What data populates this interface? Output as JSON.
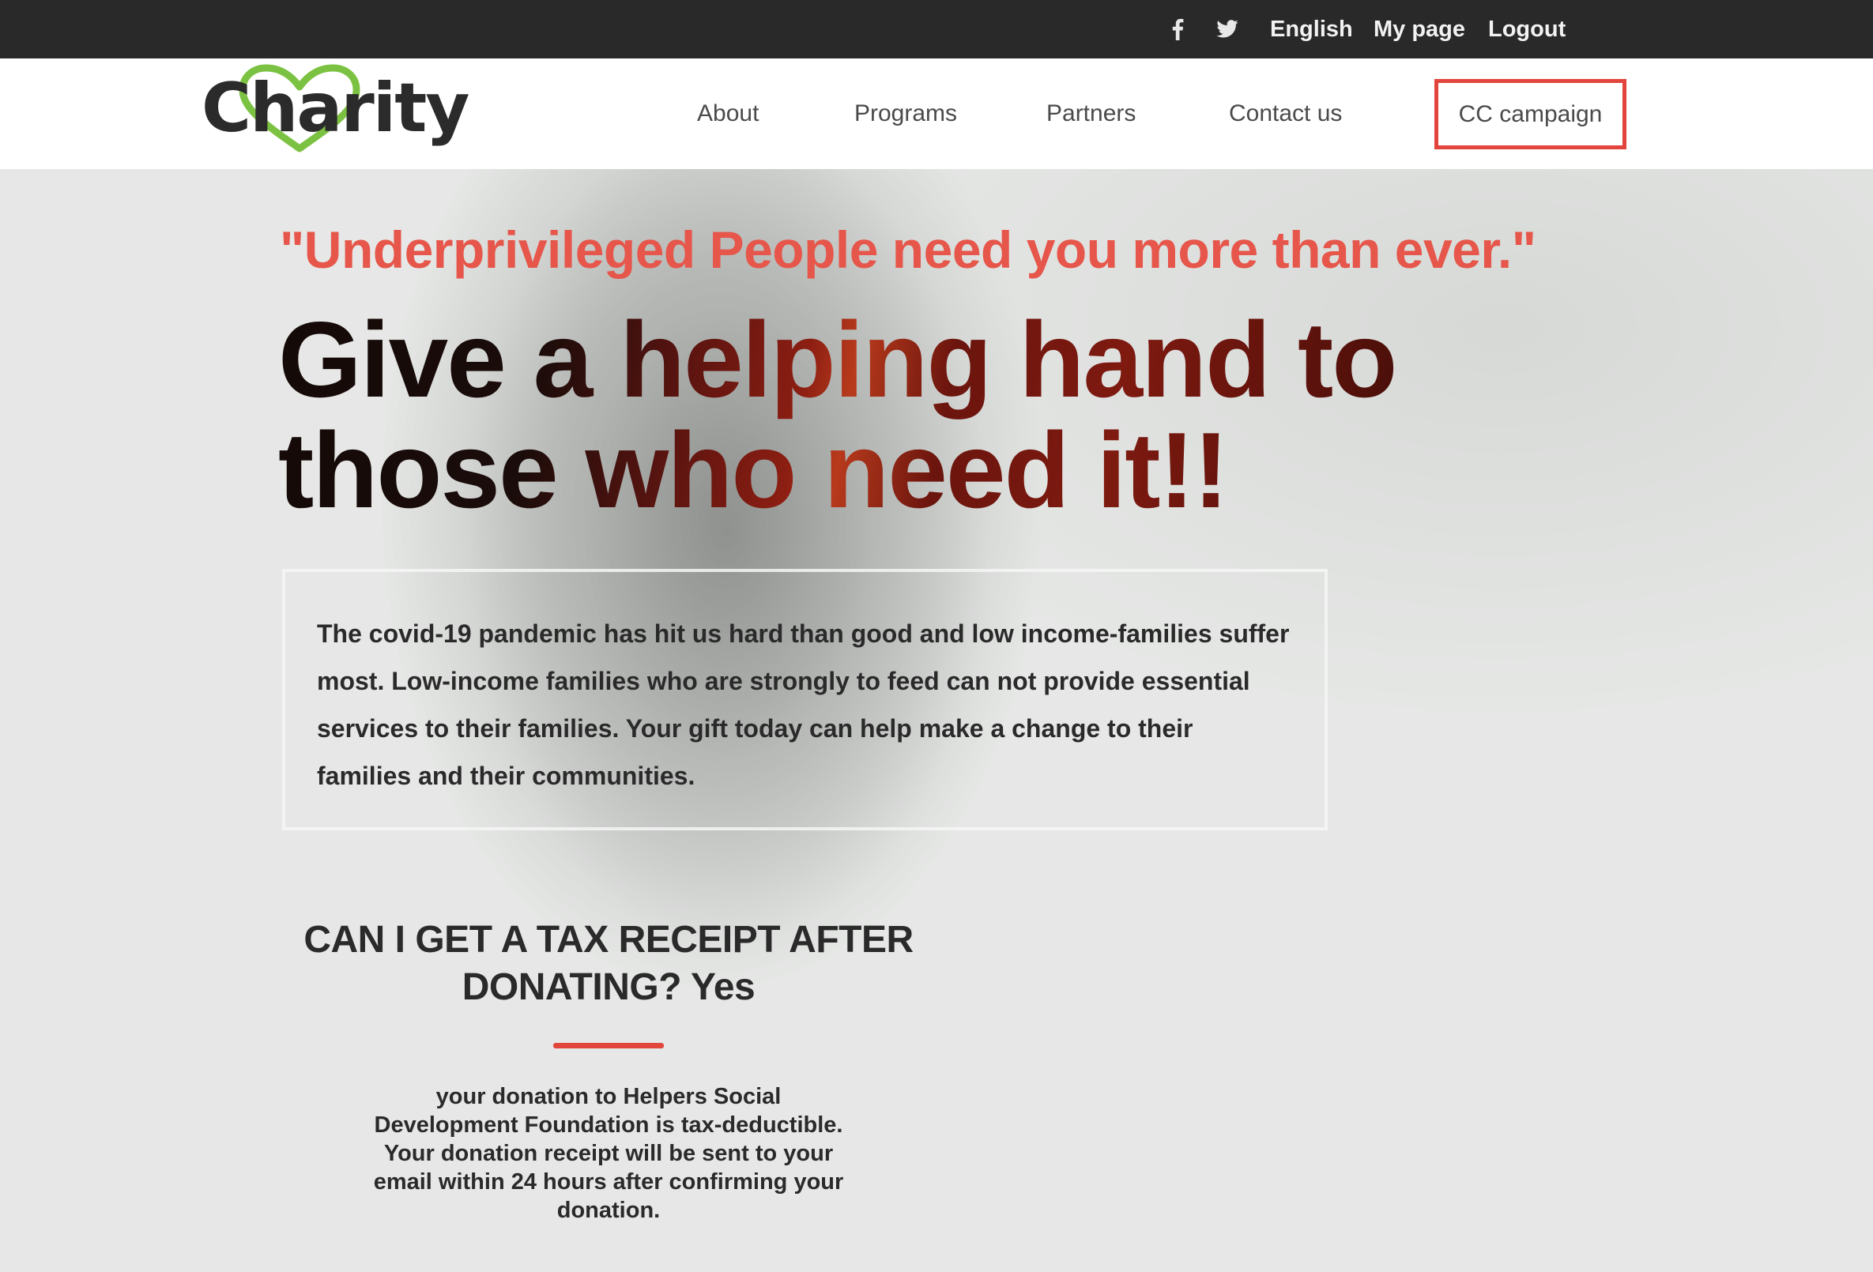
{
  "topbar": {
    "icons": [
      "facebook-icon",
      "twitter-icon"
    ],
    "language": "English",
    "my_page": "My page",
    "logout": "Logout"
  },
  "nav": {
    "logo": "Charity",
    "items": [
      "About",
      "Programs",
      "Partners",
      "Contact us"
    ],
    "cc_campaign": "CC campaign"
  },
  "hero": {
    "quote": "\"Underprivileged People need you more than ever.\"",
    "headline_line1": "Give a helping hand to",
    "headline_line2": "those who need it!!",
    "info": "The covid-19 pandemic has hit us hard than good and low income-families suffer most. Low-income families who are strongly to feed can not provide essential services to their families. Your gift today can help make a change to their families and their communities."
  },
  "tax": {
    "title": "CAN I GET A TAX RECEIPT AFTER DONATING? Yes",
    "body": "your donation to Helpers Social Development Foundation is tax-deductible. Your donation receipt will be sent to your email within 24 hours after confirming your donation."
  },
  "colors": {
    "accent": "#e2453c",
    "topbar": "#282928",
    "logo_heart": "#7cc242"
  }
}
